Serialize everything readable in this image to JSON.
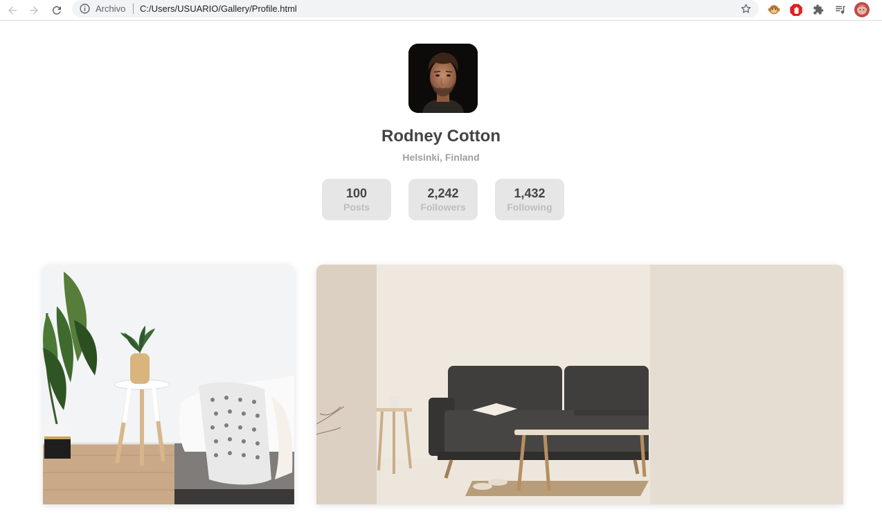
{
  "browser": {
    "scheme_label": "Archivo",
    "url": "C:/Users/USUARIO/Gallery/Profile.html"
  },
  "profile": {
    "name": "Rodney Cotton",
    "location": "Helsinki, Finland",
    "stats": [
      {
        "value": "100",
        "label": "Posts"
      },
      {
        "value": "2,242",
        "label": "Followers"
      },
      {
        "value": "1,432",
        "label": "Following"
      }
    ]
  },
  "gallery": {
    "photos": [
      "bedroom-photo",
      "living-room-sofa-photo"
    ]
  },
  "colors": {
    "name_text": "#444444",
    "muted_text": "#a0a0a0",
    "stat_background": "#e6e6e6"
  }
}
